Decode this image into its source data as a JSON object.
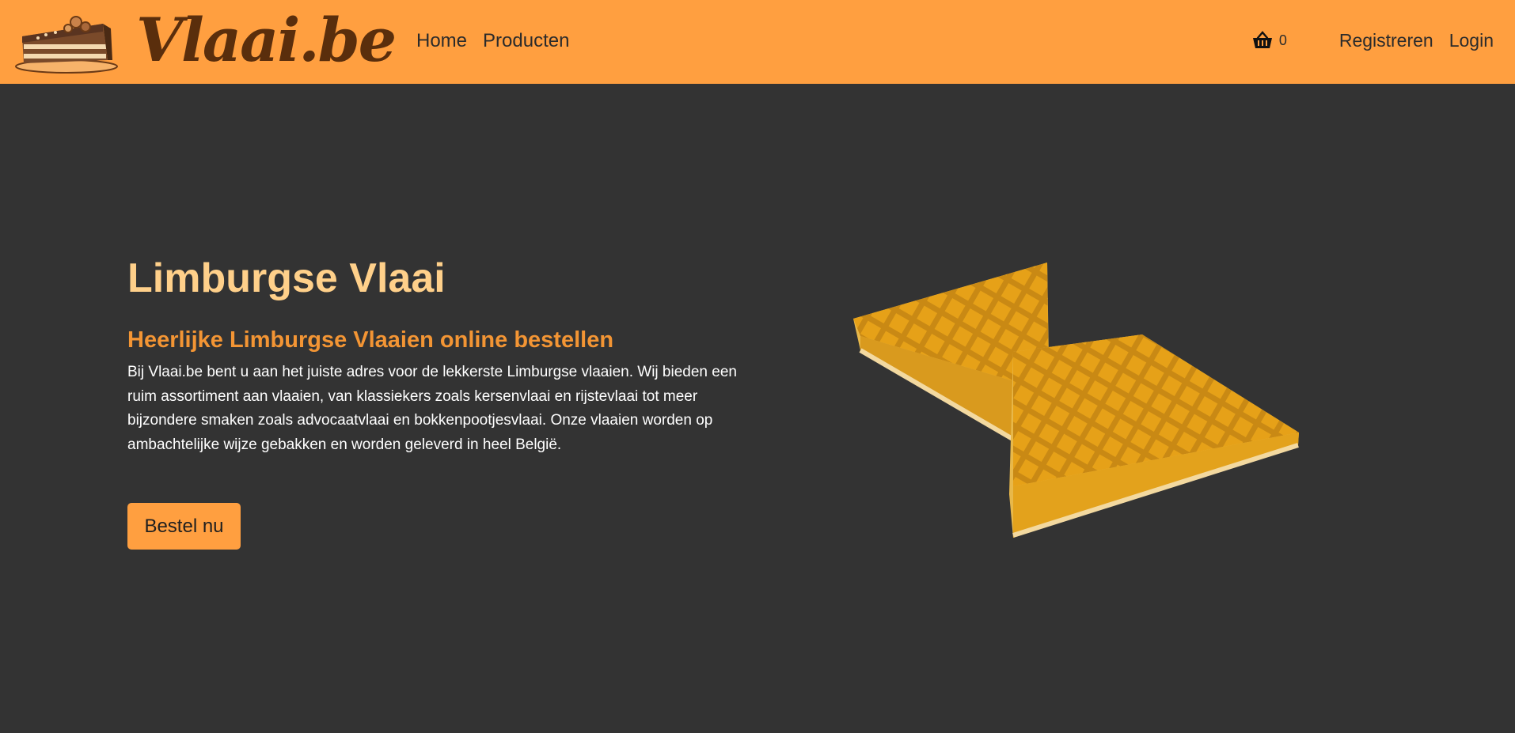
{
  "brand": {
    "name": "Vlaai.be"
  },
  "nav": {
    "links": [
      {
        "label": "Home"
      },
      {
        "label": "Producten"
      }
    ],
    "cart_count": "0",
    "register_label": "Registreren",
    "login_label": "Login"
  },
  "hero": {
    "title": "Limburgse Vlaai",
    "subtitle": "Heerlijke Limburgse Vlaaien online bestellen",
    "description": "Bij Vlaai.be bent u aan het juiste adres voor de lekkerste Limburgse vlaaien. Wij bieden een ruim assortiment aan vlaaien, van klassiekers zoals kersenvlaai en rijstevlaai tot meer bijzondere smaken zoals advocaatvlaai en bokkenpootjesvlaai. Onze vlaaien worden op ambachtelijke wijze gebakken en worden geleverd in heel België.",
    "cta_label": "Bestel nu"
  },
  "icons": {
    "logo": "cake-slice-icon",
    "cart": "shopping-basket-icon"
  },
  "colors": {
    "navbar": "#FF9F40",
    "background": "#333333",
    "title": "#FFD08A",
    "subtitle": "#F39534",
    "button": "#FF9F40"
  }
}
